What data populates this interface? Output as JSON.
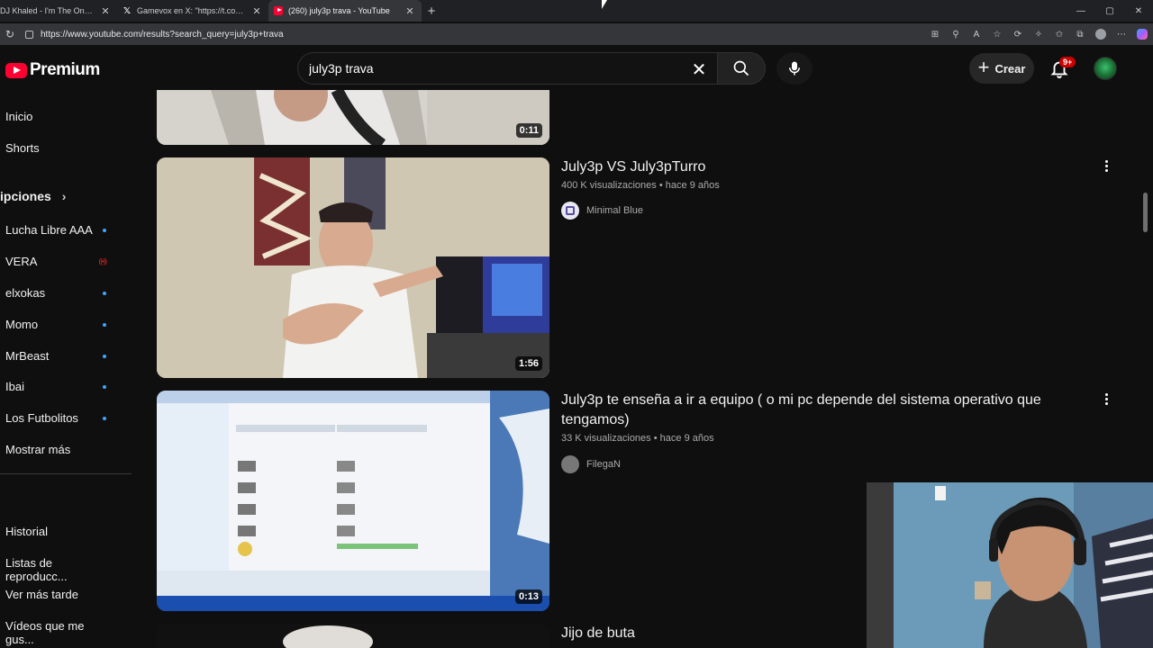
{
  "browser": {
    "tabs": [
      {
        "title": "DJ Khaled - I'm The One ft.",
        "active": false
      },
      {
        "title": "Gamevox en X: \"https://t.co/UwG",
        "active": false
      },
      {
        "title": "(260) july3p trava - YouTube",
        "active": true
      }
    ],
    "url": "https://www.youtube.com/results?search_query=july3p+trava"
  },
  "header": {
    "logo_text": "Premium",
    "search_value": "july3p trava",
    "create_label": "Crear",
    "notification_count": "9+"
  },
  "sidebar": {
    "main": [
      {
        "label": "Inicio"
      },
      {
        "label": "Shorts"
      }
    ],
    "subscriptions_title": "ipciones",
    "subscriptions": [
      {
        "label": "Lucha Libre AAA",
        "status": "dot"
      },
      {
        "label": "VERA",
        "status": "live"
      },
      {
        "label": "elxokas",
        "status": "dot"
      },
      {
        "label": "Momo",
        "status": "dot"
      },
      {
        "label": "MrBeast",
        "status": "dot"
      },
      {
        "label": "Ibai",
        "status": "dot"
      },
      {
        "label": "Los Futbolitos",
        "status": "dot"
      },
      {
        "label": "Mostrar más",
        "status": "none"
      }
    ],
    "library": [
      {
        "label": "Historial"
      },
      {
        "label": "Listas de reproducc..."
      },
      {
        "label": "Ver más tarde"
      },
      {
        "label": "Vídeos que me gus..."
      }
    ]
  },
  "results": [
    {
      "duration": "0:11"
    },
    {
      "title": "July3p VS July3pTurro",
      "views": "400 K visualizaciones",
      "age": "hace 9 años",
      "channel": "Minimal Blue",
      "duration": "1:56"
    },
    {
      "title": "July3p te enseña a ir a equipo ( o mi pc depende del sistema operativo que tengamos)",
      "views": "33 K visualizaciones",
      "age": "hace 9 años",
      "channel": "FilegaN",
      "duration": "0:13"
    },
    {
      "title": "Jijo de buta"
    }
  ],
  "colors": {
    "background": "#0f0f0f",
    "brand_red": "#ff0033",
    "subscription_dot": "#3ea6ff",
    "text_secondary": "#aaaaaa"
  },
  "icons": [
    "search-icon",
    "mic-icon",
    "bell-icon",
    "clear-icon",
    "more-vert-icon",
    "chevron-right-icon",
    "plus-icon"
  ]
}
